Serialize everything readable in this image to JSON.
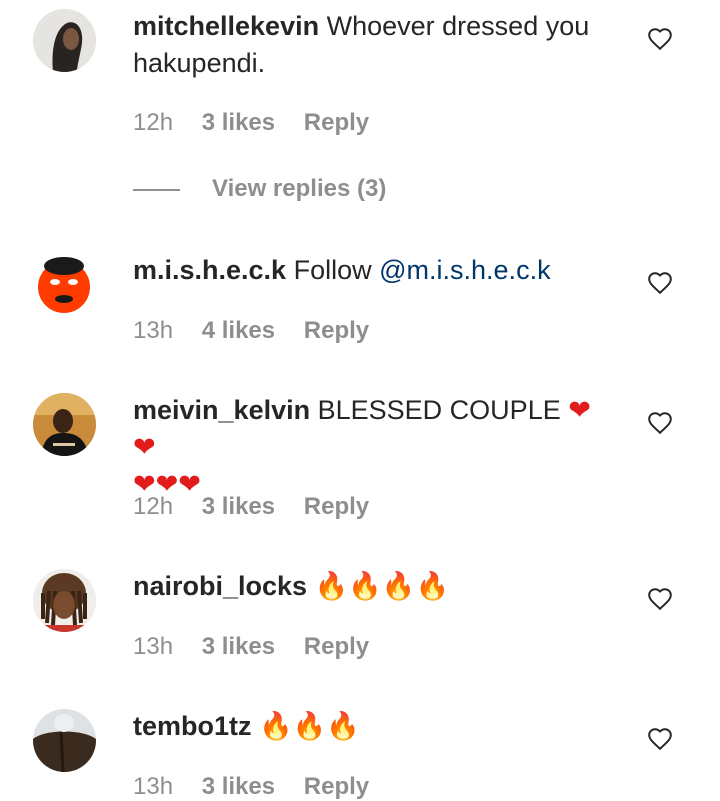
{
  "comments": [
    {
      "username": "mitchellekevin",
      "text": "Whoever dressed you hakupendi.",
      "time": "12h",
      "likes": "3 likes",
      "reply": "Reply",
      "replies_label": "View replies (3)"
    },
    {
      "username": "m.i.s.h.e.c.k",
      "text": "Follow ",
      "mention": "@m.i.s.h.e.c.k",
      "time": "13h",
      "likes": "4 likes",
      "reply": "Reply"
    },
    {
      "username": "meivin_kelvin",
      "text": "BLESSED COUPLE",
      "emojis_line1": "❤❤",
      "emojis_line2": "❤❤❤",
      "time": "12h",
      "likes": "3 likes",
      "reply": "Reply"
    },
    {
      "username": "nairobi_locks",
      "emojis": "🔥🔥🔥🔥",
      "time": "13h",
      "likes": "3 likes",
      "reply": "Reply"
    },
    {
      "username": "tembo1tz",
      "emojis": "🔥🔥🔥",
      "time": "13h",
      "likes": "3 likes",
      "reply": "Reply"
    }
  ],
  "icons": {
    "like": "heart-outline-icon"
  },
  "colors": {
    "mention": "#00376b",
    "meta": "#8e8e8e",
    "text": "#262626"
  }
}
